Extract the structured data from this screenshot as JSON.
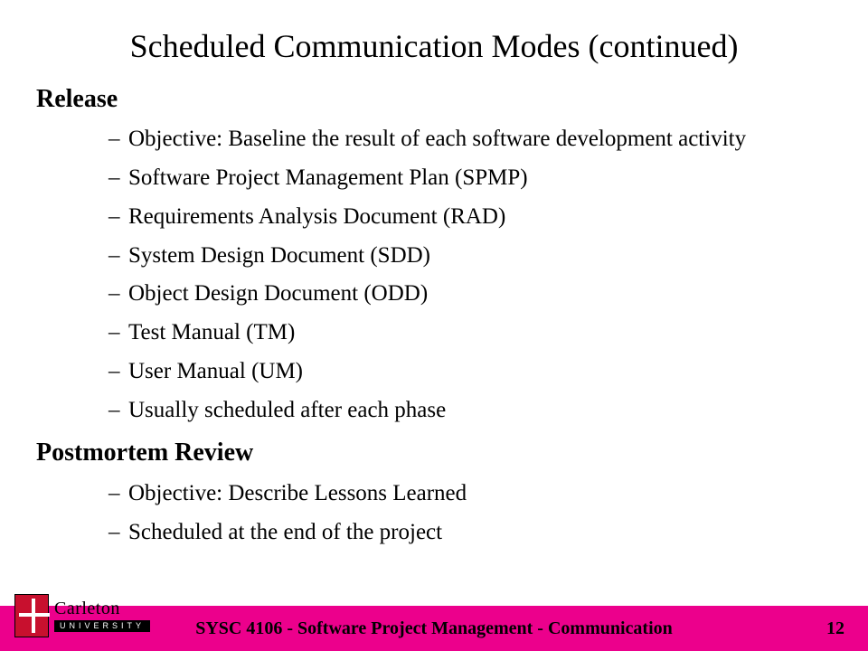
{
  "title": "Scheduled Communication Modes (continued)",
  "sections": [
    {
      "heading": "Release",
      "items": [
        "Objective: Baseline the result of each software development activity",
        " Software Project Management Plan (SPMP)",
        "Requirements Analysis Document (RAD)",
        "System Design Document (SDD)",
        "Object Design Document (ODD)",
        "Test Manual (TM)",
        "User Manual (UM)",
        "Usually scheduled after each phase"
      ]
    },
    {
      "heading": "Postmortem Review",
      "items": [
        "Objective: Describe Lessons Learned",
        "Scheduled at the end of the project"
      ]
    }
  ],
  "footer": {
    "course": "SYSC 4106 - Software Project Management - Communication",
    "page": "12"
  },
  "logo": {
    "line1": "Carleton",
    "line2": "UNIVERSITY"
  },
  "colors": {
    "footer_bg": "#ec008c",
    "crest": "#c8102e"
  }
}
